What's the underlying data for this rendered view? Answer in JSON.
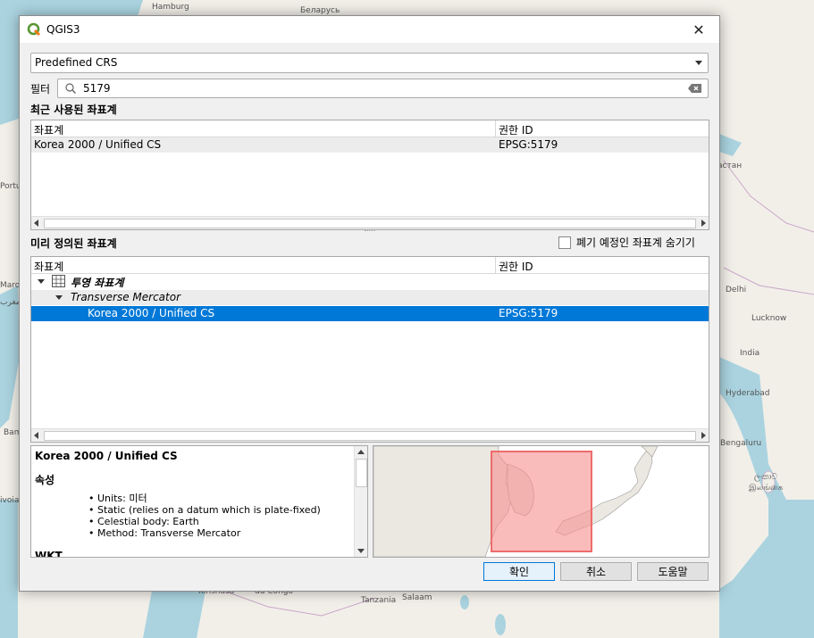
{
  "map": {
    "labels": [
      "Hamburg",
      "Беларусь",
      "астан",
      "Portu",
      "Maroc",
      "المغرب",
      "Delhi",
      "Lucknow",
      "India",
      "Hyderabad",
      "Bam",
      "Bengaluru",
      "ලංකාව",
      "இலங்கை",
      "ivoia",
      "Kinshasa",
      "du Congo",
      "Tanzania",
      "Salaam"
    ]
  },
  "window": {
    "title": "QGIS3",
    "logo_icon": "qgis-logo-icon",
    "close_label": "✕"
  },
  "crs_combo": {
    "value": "Predefined CRS"
  },
  "filter": {
    "label": "필터",
    "value": "5179"
  },
  "recent": {
    "title": "최근 사용된 좌표계",
    "columns": [
      "좌표계",
      "권한 ID"
    ],
    "rows": [
      {
        "name": "Korea 2000 / Unified CS",
        "id": "EPSG:5179"
      }
    ]
  },
  "predefined": {
    "title": "미리 정의된 좌표계",
    "hide_deprecated_label": "폐기 예정인 좌표계 숨기기",
    "columns": [
      "좌표계",
      "권한 ID"
    ],
    "group": "투영 좌표계",
    "subgroup": "Transverse Mercator",
    "selected": {
      "name": "Korea 2000 / Unified CS",
      "id": "EPSG:5179"
    }
  },
  "info": {
    "name": "Korea 2000 / Unified CS",
    "properties_label": "속성",
    "items": [
      "Units: 미터",
      "Static (relies on a datum which is plate-fixed)",
      "Celestial body: Earth",
      "Method: Transverse Mercator"
    ],
    "wkt_label": "WKT"
  },
  "buttons": {
    "ok": "확인",
    "cancel": "취소",
    "help": "도움말"
  },
  "colors": {
    "selection": "#0078d7",
    "extent_fill": "#f7a8a8",
    "extent_border": "#ee6b6b",
    "land": "#f2efe9",
    "sea": "#aad3df"
  }
}
